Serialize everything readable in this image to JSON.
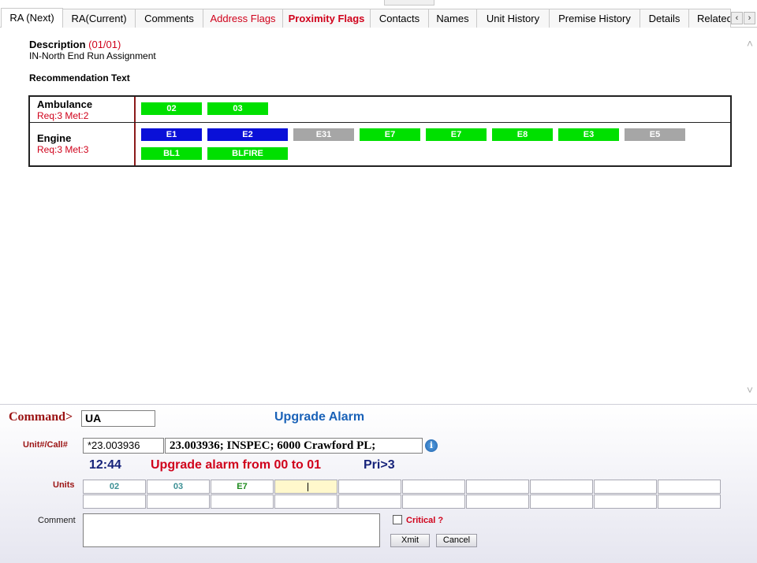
{
  "tabs": [
    {
      "label": "RA (Next)",
      "active": true
    },
    {
      "label": "RA(Current)"
    },
    {
      "label": "Comments"
    },
    {
      "label": "Address Flags",
      "color": "#d0021b"
    },
    {
      "label": "Proximity Flags",
      "color": "#d0021b",
      "bold": true
    },
    {
      "label": "Contacts"
    },
    {
      "label": "Names"
    },
    {
      "label": "Unit History"
    },
    {
      "label": "Premise History"
    },
    {
      "label": "Details"
    },
    {
      "label": "Related"
    }
  ],
  "tab_scroll": {
    "left": "‹",
    "right": "›"
  },
  "description": {
    "label": "Description",
    "count": "(01/01)",
    "text": "IN-North End Run Assignment"
  },
  "recommendation_label": "Recommendation Text",
  "ra_rows": [
    {
      "name": "Ambulance",
      "req": "Req:3  Met:2",
      "units": [
        {
          "label": "02",
          "status": "green"
        },
        {
          "label": "03",
          "status": "green"
        }
      ]
    },
    {
      "name": "Engine",
      "req": "Req:3  Met:3",
      "units": [
        {
          "label": "E1",
          "status": "blue"
        },
        {
          "label": "E2",
          "status": "blue"
        },
        {
          "label": "E31",
          "status": "gray"
        },
        {
          "label": "E7",
          "status": "green"
        },
        {
          "label": "E7",
          "status": "green"
        },
        {
          "label": "E8",
          "status": "green"
        },
        {
          "label": "E3",
          "status": "green"
        },
        {
          "label": "E5",
          "status": "gray"
        },
        {
          "label": "BL1",
          "status": "green"
        },
        {
          "label": "BLFIRE",
          "status": "green"
        }
      ]
    }
  ],
  "status_colors": {
    "green": "#00e000",
    "blue": "#0a10d8",
    "gray": "#a6a6a6"
  },
  "command": {
    "label": "Command>",
    "value": "UA",
    "description": "Upgrade Alarm"
  },
  "unit_call": {
    "label": "Unit#/Call#",
    "value": "*23.003936",
    "info": "23.003936; INSPEC; 6000 Crawford PL;"
  },
  "status_line": {
    "time": "12:44",
    "message": "Upgrade alarm from 00 to 01",
    "priority": "Pri>3"
  },
  "units_label": "Units",
  "unit_cells_row1": [
    "02",
    "03",
    "E7",
    "",
    "",
    "",
    "",
    "",
    "",
    ""
  ],
  "unit_cells_row2": [
    "",
    "",
    "",
    "",
    "",
    "",
    "",
    "",
    "",
    ""
  ],
  "comment": {
    "label": "Comment",
    "value": ""
  },
  "critical": {
    "label": "Critical ?",
    "checked": false
  },
  "buttons": {
    "xmit": "Xmit",
    "cancel": "Cancel"
  }
}
